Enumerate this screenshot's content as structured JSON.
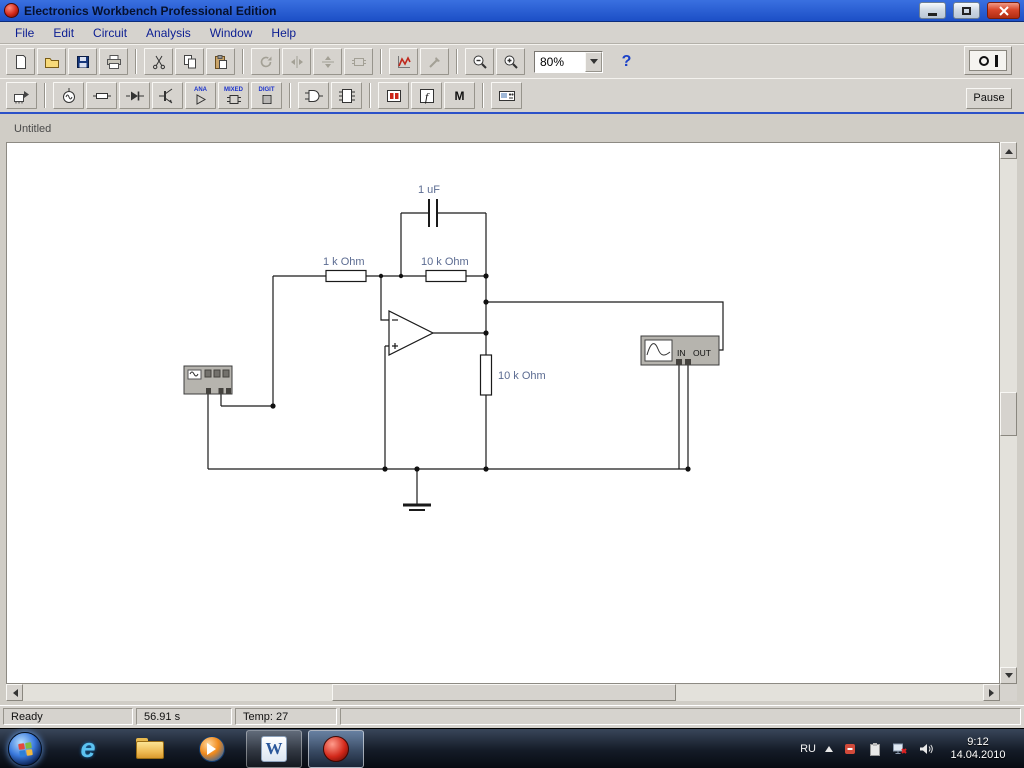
{
  "window": {
    "title": "Electronics Workbench Professional Edition"
  },
  "menu": {
    "items": [
      "File",
      "Edit",
      "Circuit",
      "Analysis",
      "Window",
      "Help"
    ]
  },
  "toolbar": {
    "zoom_value": "80%",
    "help_glyph": "?"
  },
  "parts_bar": {
    "ana_label": "ANA",
    "mixed_label": "MIXED",
    "digit_label": "DIGIT",
    "controls_glyph": "f",
    "misc_glyph": "M"
  },
  "simulation": {
    "pause_label": "Pause"
  },
  "document": {
    "title": "Untitled"
  },
  "circuit": {
    "capacitor_label": "1 uF",
    "r1_label": "1 k Ohm",
    "r2_label": "10 k Ohm",
    "r3_label": "10 k Ohm",
    "scope_in_label": "IN",
    "scope_out_label": "OUT"
  },
  "status_bar": {
    "ready": "Ready",
    "sim_time": "56.91 s",
    "temperature": "Temp: 27"
  },
  "taskbar": {
    "language": "RU",
    "clock_time": "9:12",
    "clock_date": "14.04.2010",
    "ie_glyph": "e",
    "word_glyph": "W"
  }
}
